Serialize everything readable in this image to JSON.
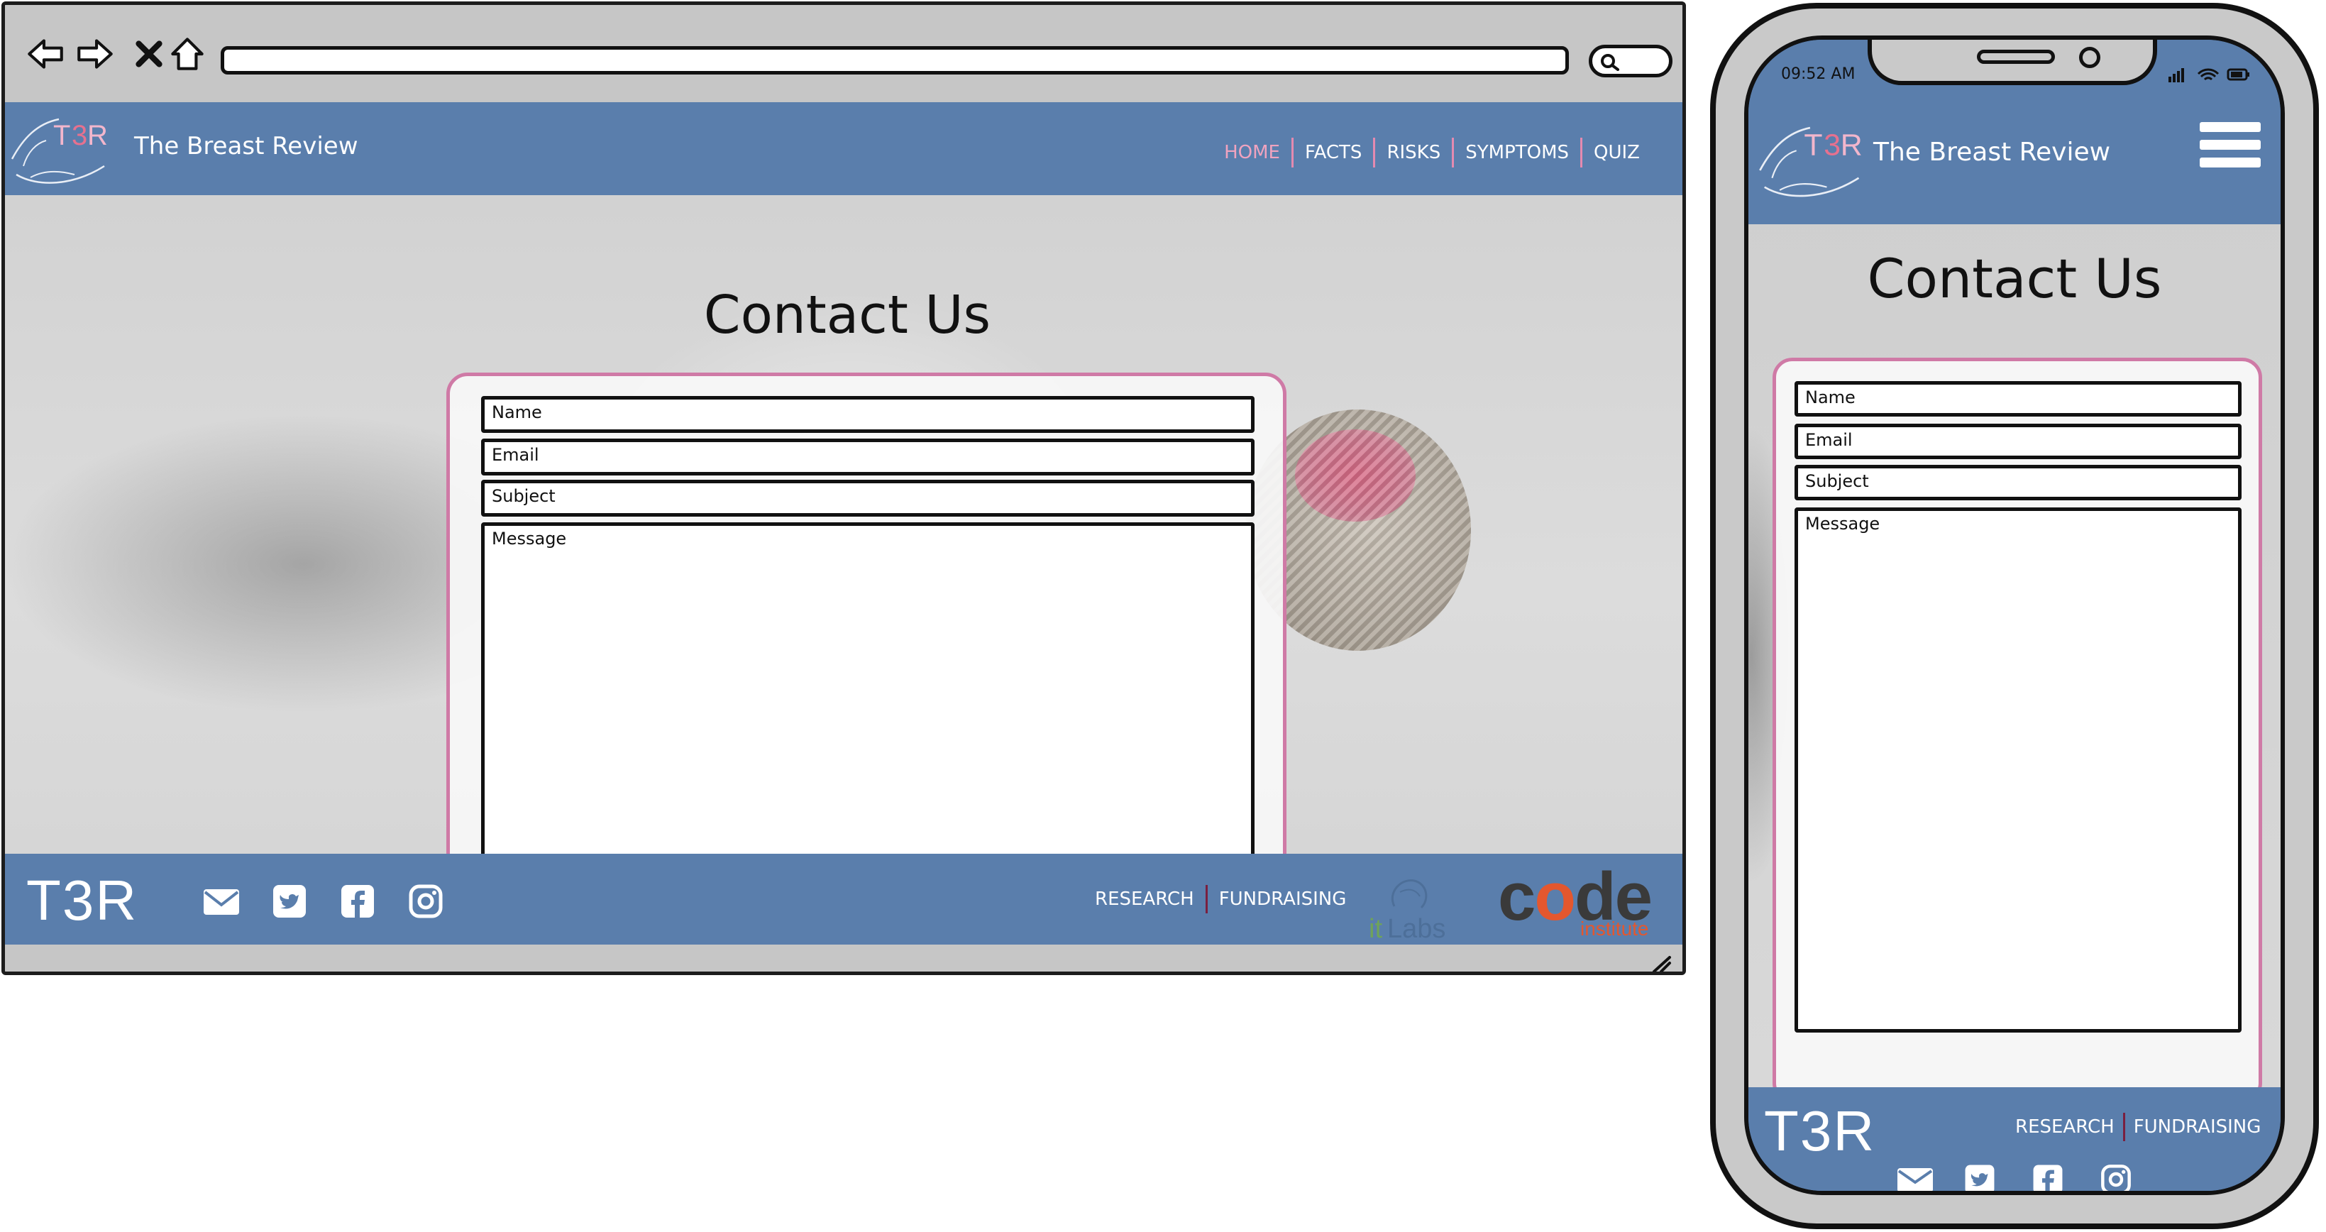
{
  "site": {
    "title": "The Breast Review",
    "logo_text": "T3R",
    "logo_letters": [
      "T",
      "3",
      "R"
    ],
    "brand_color": "#5a7eac",
    "accent_color": "#e48ab0"
  },
  "nav": {
    "items": [
      {
        "label": "HOME",
        "active": true
      },
      {
        "label": "FACTS"
      },
      {
        "label": "RISKS"
      },
      {
        "label": "SYMPTOMS"
      },
      {
        "label": "QUIZ"
      }
    ]
  },
  "page": {
    "heading": "Contact Us"
  },
  "form": {
    "name_placeholder": "Name",
    "email_placeholder": "Email",
    "subject_placeholder": "Subject",
    "message_placeholder": "Message"
  },
  "footer": {
    "brand": "T3R",
    "social_icons": [
      "envelope-icon",
      "twitter-icon",
      "facebook-icon",
      "instagram-icon"
    ],
    "links": [
      {
        "label": "RESEARCH"
      },
      {
        "label": "FUNDRAISING"
      }
    ],
    "partner_itlabs": "itLabs",
    "partner_code": "code",
    "partner_code_o": "o",
    "partner_code_rest": "de",
    "partner_code_c": "c",
    "partner_institute": "institute"
  },
  "phone": {
    "status_time": "09:52 AM"
  }
}
